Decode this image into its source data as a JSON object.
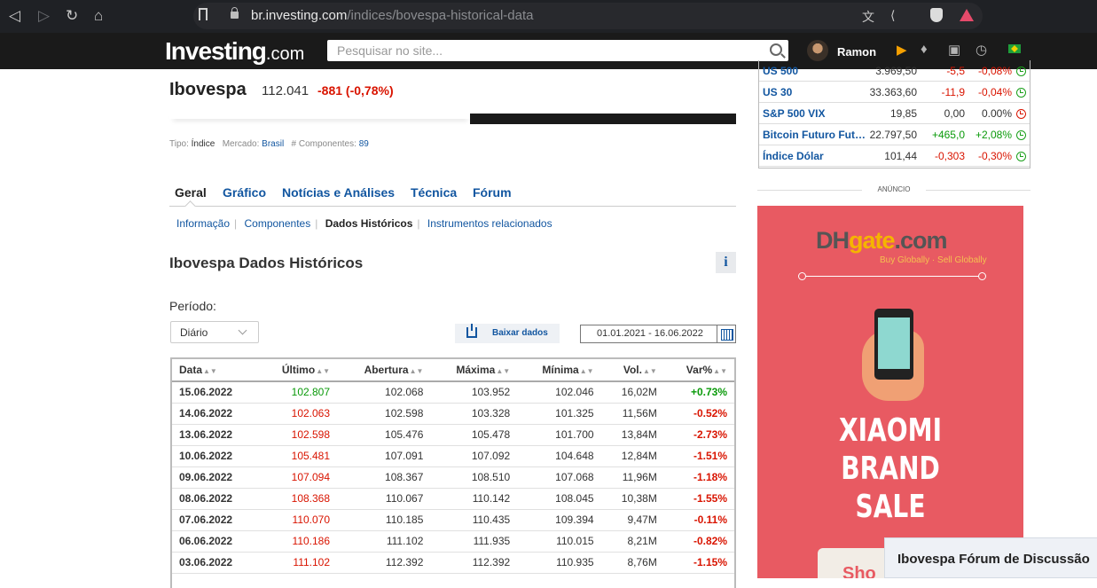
{
  "browser": {
    "url_host": "br.investing.com",
    "url_path": "/indices/bovespa-historical-data"
  },
  "header": {
    "logo_main": "Investing",
    "logo_dom": ".com",
    "search_placeholder": "Pesquisar no site...",
    "user_name": "Ramon"
  },
  "quote": {
    "title": "Ibovespa",
    "price": "112.041",
    "change": "-881",
    "change_pct": "(-0,78%)"
  },
  "meta": {
    "tipo_label": "Tipo:",
    "tipo_value": "Índice",
    "mercado_label": "Mercado:",
    "mercado_value": "Brasil",
    "comp_label": "# Componentes:",
    "comp_value": "89"
  },
  "tabs": [
    "Geral",
    "Gráfico",
    "Notícias e Análises",
    "Técnica",
    "Fórum"
  ],
  "subnav": {
    "items": [
      "Informação",
      "Componentes",
      "Dados Históricos",
      "Instrumentos relacionados"
    ],
    "current": "Dados Históricos"
  },
  "section": {
    "title": "Ibovespa Dados Históricos",
    "info_label": "i",
    "period_label": "Período:",
    "period_value": "Diário",
    "download_label": "Baixar dados",
    "date_range": "01.01.2021 - 16.06.2022"
  },
  "table": {
    "columns": [
      "Data",
      "Último",
      "Abertura",
      "Máxima",
      "Mínima",
      "Vol.",
      "Var%"
    ],
    "rows": [
      {
        "date": "15.06.2022",
        "last": "102.807",
        "open": "102.068",
        "high": "103.952",
        "low": "102.046",
        "vol": "16,02M",
        "pct": "+0.73%",
        "dir": "up"
      },
      {
        "date": "14.06.2022",
        "last": "102.063",
        "open": "102.598",
        "high": "103.328",
        "low": "101.325",
        "vol": "11,56M",
        "pct": "-0.52%",
        "dir": "down"
      },
      {
        "date": "13.06.2022",
        "last": "102.598",
        "open": "105.476",
        "high": "105.478",
        "low": "101.700",
        "vol": "13,84M",
        "pct": "-2.73%",
        "dir": "down"
      },
      {
        "date": "10.06.2022",
        "last": "105.481",
        "open": "107.091",
        "high": "107.092",
        "low": "104.648",
        "vol": "12,84M",
        "pct": "-1.51%",
        "dir": "down"
      },
      {
        "date": "09.06.2022",
        "last": "107.094",
        "open": "108.367",
        "high": "108.510",
        "low": "107.068",
        "vol": "11,96M",
        "pct": "-1.18%",
        "dir": "down"
      },
      {
        "date": "08.06.2022",
        "last": "108.368",
        "open": "110.067",
        "high": "110.142",
        "low": "108.045",
        "vol": "10,38M",
        "pct": "-1.55%",
        "dir": "down"
      },
      {
        "date": "07.06.2022",
        "last": "110.070",
        "open": "110.185",
        "high": "110.435",
        "low": "109.394",
        "vol": "9,47M",
        "pct": "-0.11%",
        "dir": "down"
      },
      {
        "date": "06.06.2022",
        "last": "110.186",
        "open": "111.102",
        "high": "111.935",
        "low": "110.015",
        "vol": "8,21M",
        "pct": "-0.82%",
        "dir": "down"
      },
      {
        "date": "03.06.2022",
        "last": "111.102",
        "open": "112.392",
        "high": "112.392",
        "low": "110.935",
        "vol": "8,76M",
        "pct": "-1.15%",
        "dir": "down"
      }
    ]
  },
  "sidebar": {
    "indices": [
      {
        "name": "US 500",
        "value": "3.969,50",
        "chg": "-5,5",
        "pct": "-0,08%",
        "dir": "down",
        "status": "open"
      },
      {
        "name": "US 30",
        "value": "33.363,60",
        "chg": "-11,9",
        "pct": "-0,04%",
        "dir": "down",
        "status": "open"
      },
      {
        "name": "S&P 500 VIX",
        "value": "19,85",
        "chg": "0,00",
        "pct": "0.00%",
        "dir": "neutral",
        "status": "closed"
      },
      {
        "name": "Bitcoin Futuro Futuros",
        "value": "22.797,50",
        "chg": "+465,0",
        "pct": "+2,08%",
        "dir": "up",
        "status": "open"
      },
      {
        "name": "Índice Dólar",
        "value": "101,44",
        "chg": "-0,303",
        "pct": "-0,30%",
        "dir": "down",
        "status": "open"
      }
    ],
    "ad_label": "ANÚNCIO",
    "ad": {
      "brand_dh": "DH",
      "brand_gate": "gate",
      "brand_com": ".com",
      "tagline": "Buy Globally · Sell Globally",
      "headline": [
        "XIAOMI",
        "BRAND",
        "SALE"
      ],
      "button_peek": "Sho"
    },
    "forum_label": "Ibovespa Fórum de Discussão"
  },
  "colors": {
    "link": "#1256a0",
    "up": "#0a9a0a",
    "down": "#d91400",
    "header_bg": "#1a1a1a",
    "ad_bg": "#e85a62"
  }
}
